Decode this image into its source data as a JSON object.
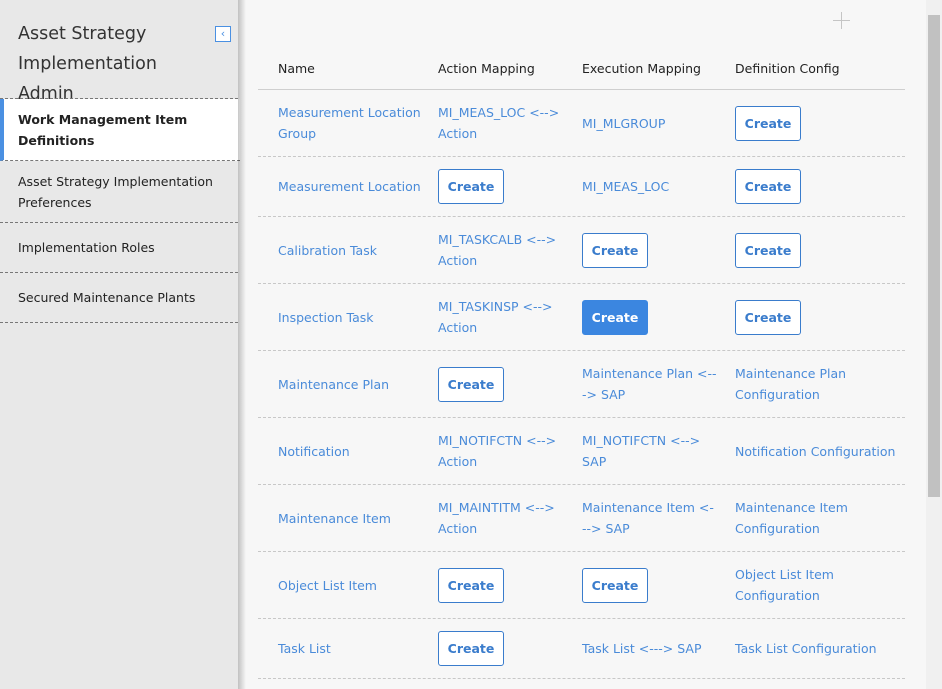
{
  "sidebar": {
    "title": "Asset Strategy Implementation Admin",
    "collapse_icon": "collapse-left-icon",
    "items": [
      {
        "label": "Work Management Item Definitions",
        "active": true
      },
      {
        "label": "Asset Strategy Implementation Preferences",
        "active": false
      },
      {
        "label": "Implementation Roles",
        "active": false
      },
      {
        "label": "Secured Maintenance Plants",
        "active": false
      }
    ]
  },
  "toolbar": {
    "add_icon": "plus-icon"
  },
  "table": {
    "headers": {
      "name": "Name",
      "action": "Action Mapping",
      "execution": "Execution Mapping",
      "definition": "Definition Config"
    },
    "rows": [
      {
        "name": "Measurement Location Group",
        "action": "MI_MEAS_LOC <--> Action",
        "execution": "MI_MLGROUP",
        "definition": "Create"
      },
      {
        "name": "Measurement Location",
        "action": "Create",
        "execution": "MI_MEAS_LOC",
        "definition": "Create"
      },
      {
        "name": "Calibration Task",
        "action": "MI_TASKCALB <--> Action",
        "execution": "Create",
        "definition": "Create"
      },
      {
        "name": "Inspection Task",
        "action": "MI_TASKINSP <--> Action",
        "execution": "Create",
        "definition": "Create"
      },
      {
        "name": "Maintenance Plan",
        "action": "Create",
        "execution": "Maintenance Plan <---> SAP",
        "definition": "Maintenance Plan Configuration"
      },
      {
        "name": "Notification",
        "action": "MI_NOTIFCTN <--> Action",
        "execution": "MI_NOTIFCTN <--> SAP",
        "definition": "Notification Configuration"
      },
      {
        "name": "Maintenance Item",
        "action": "MI_MAINTITM <--> Action",
        "execution": "Maintenance Item <---> SAP",
        "definition": "Maintenance Item Configuration"
      },
      {
        "name": "Object List Item",
        "action": "Create",
        "execution": "Create",
        "definition": "Object List Item Configuration"
      },
      {
        "name": "Task List",
        "action": "Create",
        "execution": "Task List <---> SAP",
        "definition": "Task List Configuration"
      }
    ]
  },
  "colors": {
    "accent": "#3b86e0",
    "link": "#4a8bd9",
    "sidebar_bg": "#e8e8e8",
    "main_bg": "#f7f7f7"
  }
}
